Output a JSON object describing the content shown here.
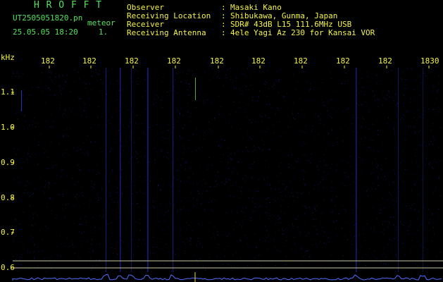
{
  "header": {
    "logo": "H R O F F T",
    "filename": "UT2505051820.pn",
    "mode": "meteor",
    "timestamp": "25.05.05 18:20",
    "index": "1."
  },
  "info": {
    "keys": [
      "Observer",
      "Receiving Location",
      "Receiver",
      "Receiving Antenna"
    ],
    "sep": [
      ":",
      ":",
      ":",
      ":"
    ],
    "values": [
      "Masaki Kano",
      "Shibukawa, Gunma, Japan",
      "SDR# 43dB L15 111.6MHz USB",
      "4ele Yagi Az 230 for Kansai VOR"
    ]
  },
  "axis": {
    "unit": "kHz",
    "x_ticks": [
      "182",
      "182",
      "182",
      "182",
      "182",
      "182",
      "182",
      "182",
      "182",
      "1830"
    ],
    "y_ticks": [
      "1.1",
      "1.0",
      "0.9",
      "0.8",
      "0.7",
      "0.6"
    ]
  },
  "colors": {
    "background": "#000000",
    "logo_green": "#55e35a",
    "label_yellow": "#f5f542",
    "signal_blue": "#2a3cff",
    "ref_line": "#c9c9a0"
  }
}
